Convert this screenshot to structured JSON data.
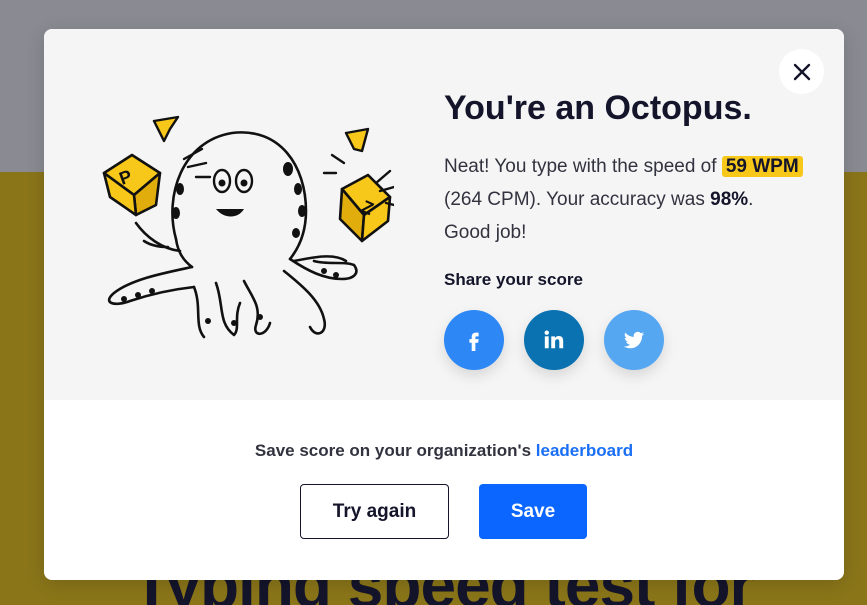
{
  "background": {
    "heading": "Typing speed test for"
  },
  "modal": {
    "title": "You're an Octopus.",
    "result": {
      "intro": "Neat! You type with the speed of",
      "wpm": "59 WPM",
      "cpm_text": "(264 CPM). Your accuracy was",
      "accuracy": "98%",
      "outro": ". Good job!"
    },
    "share": {
      "title": "Share your score",
      "buttons": [
        {
          "network": "facebook",
          "icon": "facebook-icon",
          "color": "#2d88f5"
        },
        {
          "network": "linkedin",
          "icon": "linkedin-icon",
          "color": "#0a72b1"
        },
        {
          "network": "twitter",
          "icon": "twitter-icon",
          "color": "#55a7f2"
        }
      ]
    },
    "illustration": {
      "letters": [
        "P",
        "Z"
      ]
    },
    "save": {
      "prompt": "Save score on your organization's",
      "link_label": "leaderboard",
      "try_again_label": "Try again",
      "save_label": "Save"
    }
  },
  "colors": {
    "accent_yellow": "#f7c71a",
    "primary_blue": "#0a66ff",
    "dark_text": "#14142b"
  }
}
